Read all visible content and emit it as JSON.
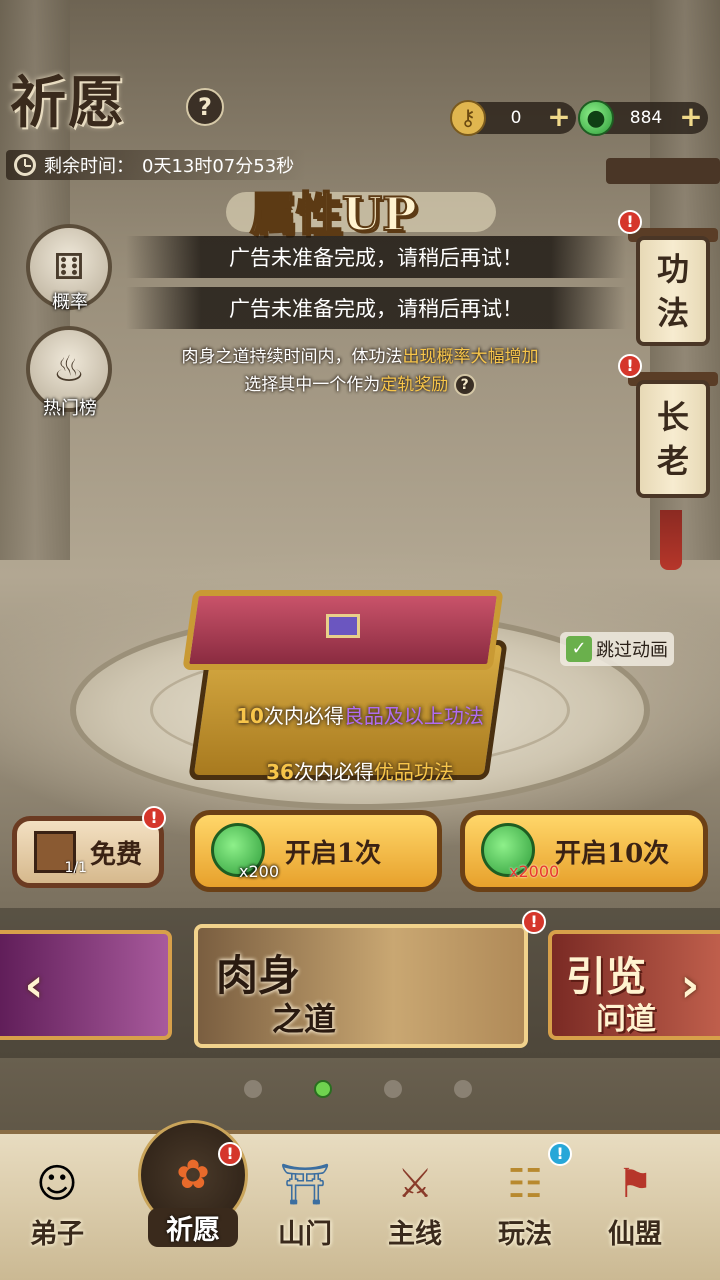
{
  "header": {
    "title": "祈愿",
    "help_label": "?",
    "timer_label": "剩余时间：",
    "timer_value": "0天13时07分53秒"
  },
  "currency": {
    "key_amount": "0",
    "jade_amount": "884",
    "plus": "+"
  },
  "banner": {
    "title": "属性UP",
    "description_a": "肉身之道持续时间内，体功法",
    "description_highlight": "出现概率大幅增加",
    "description_b": "选择其中一个作为",
    "description_highlight2": "定轨奖励"
  },
  "toasts": [
    "广告未准备完成，请稍后再试！",
    "广告未准备完成，请稍后再试！"
  ],
  "side_buttons": {
    "probability": "概率",
    "hot_list": "热门榜"
  },
  "right_tabs": {
    "skills": [
      "功",
      "法"
    ],
    "elder": [
      "长",
      "老"
    ],
    "badge": "!"
  },
  "chest": {
    "guarantee1_num": "10",
    "guarantee1_text": "次内必得",
    "guarantee1_item": "良品及以上功法",
    "guarantee2_num": "36",
    "guarantee2_text": "次内必得",
    "guarantee2_item": "优品功法",
    "skip_label": "跳过动画"
  },
  "actions": {
    "free_label": "免费",
    "free_count": "1/1",
    "open1_label": "开启1次",
    "open1_cost": "x200",
    "open10_label": "开启10次",
    "open10_cost": "x2000"
  },
  "banners": {
    "left_partial": "",
    "mid_line1": "肉身",
    "mid_line2": "之道",
    "right_line1": "引览",
    "right_line2": "问道"
  },
  "pagination": {
    "count": 4,
    "active": 1
  },
  "nav": [
    {
      "label": "弟子",
      "icon": "disciple-icon"
    },
    {
      "label": "祈愿",
      "icon": "wish-icon"
    },
    {
      "label": "山门",
      "icon": "sect-gate-icon"
    },
    {
      "label": "主线",
      "icon": "mainline-icon"
    },
    {
      "label": "玩法",
      "icon": "gameplay-icon"
    },
    {
      "label": "仙盟",
      "icon": "alliance-icon"
    }
  ],
  "colors": {
    "gold_text": "#f7c54a",
    "purple_text": "#b16cf0",
    "badge_red": "#d5362b",
    "badge_blue": "#27a7d8",
    "jade_green": "#2e9d3a"
  }
}
